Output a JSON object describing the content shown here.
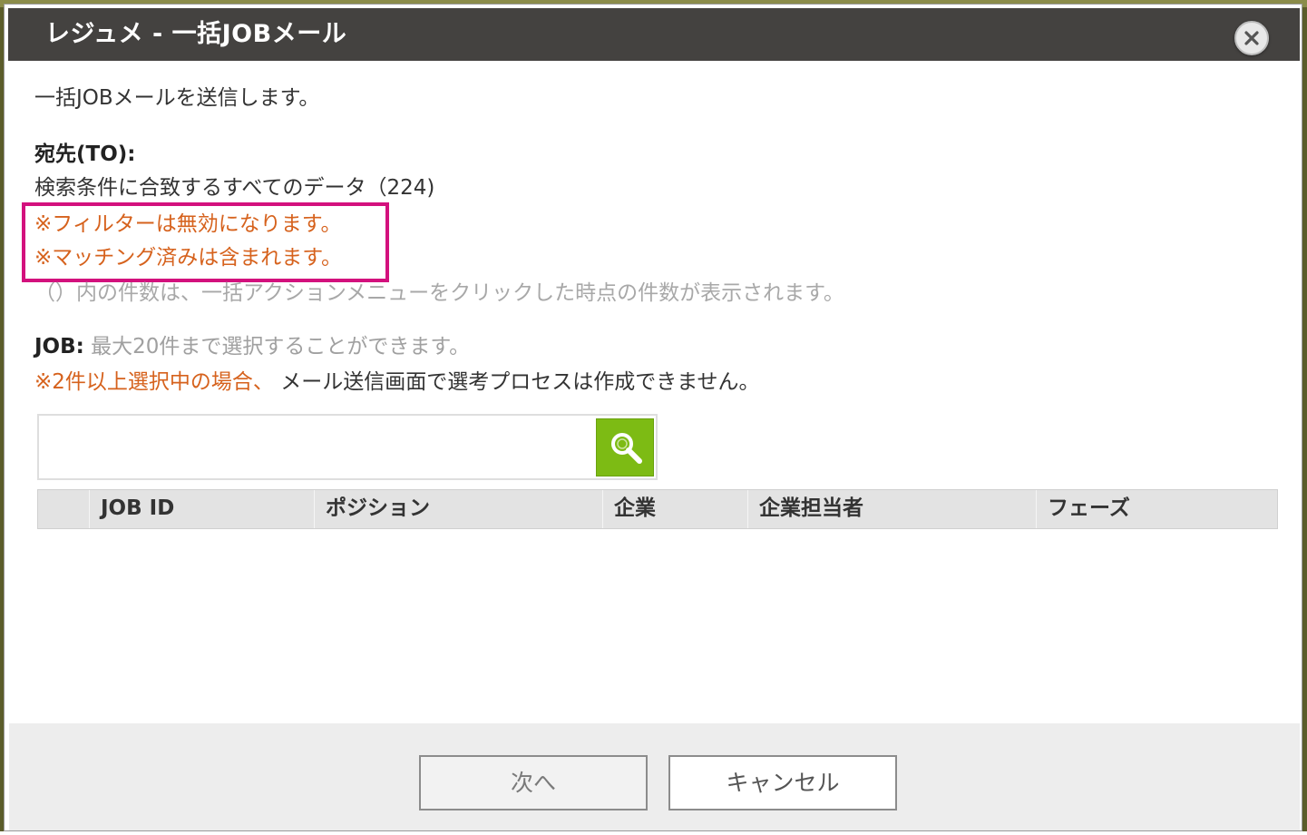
{
  "dialog": {
    "title": "レジュメ - 一括JOBメール",
    "close_icon": "close-icon"
  },
  "content": {
    "intro": "一括JOBメールを送信します。",
    "to_label": "宛先(TO):",
    "to_desc": "検索条件に合致するすべてのデータ（224)",
    "warn_filter": "※フィルターは無効になります。",
    "warn_matching": "※マッチング済みは含まれます。",
    "hint": "（）内の件数は、一括アクションメニューをクリックした時点の件数が表示されます。",
    "job_label": "JOB:",
    "job_desc": " 最大20件まで選択することができます。",
    "multi_warn": "※2件以上選択中の場合、",
    "multi_note": " メール送信画面で選考プロセスは作成できません。"
  },
  "search": {
    "placeholder": "",
    "value": "",
    "button_icon": "search-icon"
  },
  "table": {
    "columns": [
      "",
      "JOB ID",
      "ポジション",
      "企業",
      "企業担当者",
      "フェーズ"
    ]
  },
  "footer": {
    "next_label": "次へ",
    "cancel_label": "キャンセル"
  },
  "colors": {
    "titlebar": "#444240",
    "warning": "#d6621d",
    "highlight": "#d3117d",
    "search_button": "#7dbb14"
  }
}
